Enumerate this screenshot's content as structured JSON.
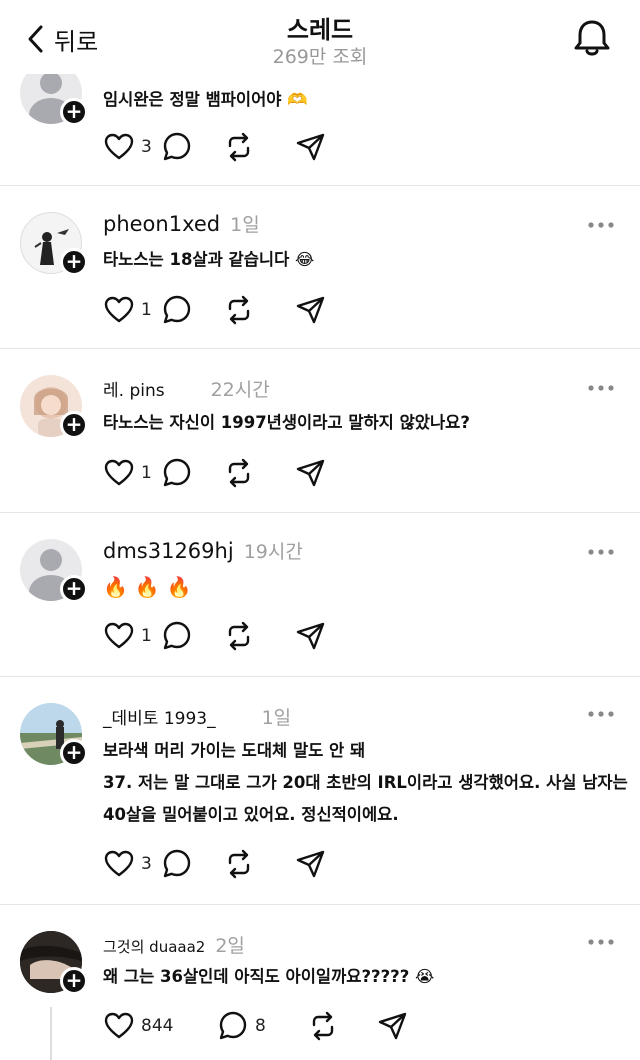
{
  "header": {
    "back_label": "뒤로",
    "title": "스레드",
    "subtitle": "269만 조회"
  },
  "posts": [
    {
      "username": "",
      "time": "",
      "avatar": "default",
      "text": "임시완은 정말 뱀파이어야 🫶",
      "likes": "3",
      "comments": ""
    },
    {
      "username": "pheon1xed",
      "time": "1일",
      "avatar": "drawing",
      "text": "타노스는 18살과 같습니다 😂",
      "likes": "1",
      "comments": ""
    },
    {
      "username": "레. pins",
      "time": "22시간",
      "avatar": "illustration",
      "text": "타노스는 자신이 1997년생이라고 말하지 않았나요?",
      "likes": "1",
      "comments": ""
    },
    {
      "username": "dms31269hj",
      "time": "19시간",
      "avatar": "default",
      "text": "🔥 🔥 🔥",
      "likes": "1",
      "comments": ""
    },
    {
      "username": "_데비토 1993_",
      "time": "1일",
      "avatar": "photo",
      "text_lines": [
        "보라색 머리 가이는 도대체 말도 안 돼",
        "37. 저는 말 그대로 그가 20대 초반의 IRL이라고 생각했어요. 사실 남자는",
        "40살을 밀어붙이고 있어요. 정신적이에요."
      ],
      "likes": "3",
      "comments": ""
    },
    {
      "username": "그것의 duaaa2",
      "time": "2일",
      "avatar": "dark",
      "text": "왜 그는 36살인데 아직도 아이일까요????? 😭",
      "likes": "844",
      "comments": "8"
    }
  ],
  "colors": {
    "text": "#111111",
    "muted": "#a0a0a0",
    "divider": "#e6e6e6"
  }
}
